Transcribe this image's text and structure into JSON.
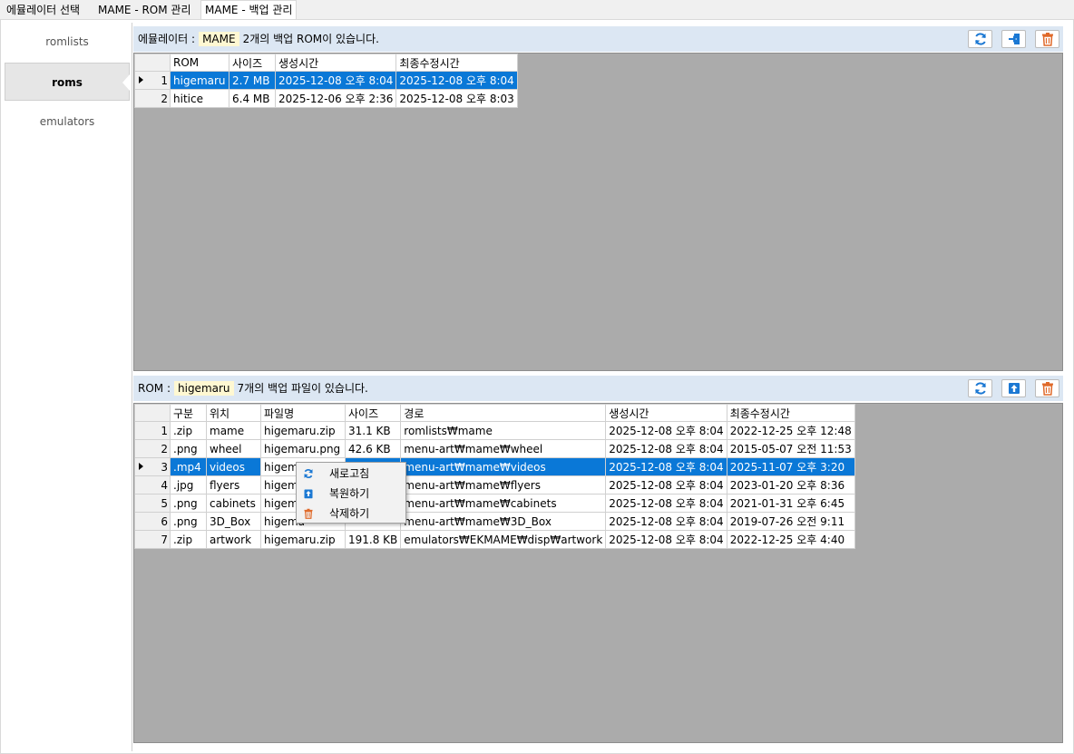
{
  "tabs": [
    {
      "label": "에뮬레이터 선택"
    },
    {
      "label": "MAME - ROM 관리"
    },
    {
      "label": "MAME - 백업 관리"
    }
  ],
  "nav": {
    "items": [
      {
        "label": "romlists"
      },
      {
        "label": "roms"
      },
      {
        "label": "emulators"
      }
    ]
  },
  "top_panel": {
    "label_prefix": "에뮬레이터 :",
    "emulator": "MAME",
    "message": "2개의 백업 ROM이 있습니다.",
    "columns": [
      "ROM",
      "사이즈",
      "생성시간",
      "최종수정시간"
    ],
    "rows": [
      {
        "num": "1",
        "rom": "higemaru",
        "size": "2.7 MB",
        "created": "2025-12-08 오후 8:04",
        "modified": "2025-12-08 오후 8:04"
      },
      {
        "num": "2",
        "rom": "hitice",
        "size": "6.4 MB",
        "created": "2025-12-06 오후 2:36",
        "modified": "2025-12-08 오후 8:03"
      }
    ]
  },
  "bottom_panel": {
    "label_prefix": "ROM :",
    "rom": "higemaru",
    "message": "7개의 백업 파일이 있습니다.",
    "columns": [
      "구분",
      "위치",
      "파일명",
      "사이즈",
      "경로",
      "생성시간",
      "최종수정시간"
    ],
    "rows": [
      {
        "num": "1",
        "type": ".zip",
        "loc": "mame",
        "file": "higemaru.zip",
        "size": "31.1 KB",
        "path": "romlists₩mame",
        "created": "2025-12-08 오후 8:04",
        "modified": "2022-12-25 오후 12:48"
      },
      {
        "num": "2",
        "type": ".png",
        "loc": "wheel",
        "file": "higemaru.png",
        "size": "42.6 KB",
        "path": "menu-art₩mame₩wheel",
        "created": "2025-12-08 오후 8:04",
        "modified": "2015-05-07 오전 11:53"
      },
      {
        "num": "3",
        "type": ".mp4",
        "loc": "videos",
        "file": "higema",
        "size": "",
        "path": "menu-art₩mame₩videos",
        "created": "2025-12-08 오후 8:04",
        "modified": "2025-11-07 오후 3:20"
      },
      {
        "num": "4",
        "type": ".jpg",
        "loc": "flyers",
        "file": "higema",
        "size": "",
        "path": "menu-art₩mame₩flyers",
        "created": "2025-12-08 오후 8:04",
        "modified": "2023-01-20 오후 8:36"
      },
      {
        "num": "5",
        "type": ".png",
        "loc": "cabinets",
        "file": "higema",
        "size": "",
        "path": "menu-art₩mame₩cabinets",
        "created": "2025-12-08 오후 8:04",
        "modified": "2021-01-31 오후 6:45"
      },
      {
        "num": "6",
        "type": ".png",
        "loc": "3D_Box",
        "file": "higema",
        "size": "",
        "path": "menu-art₩mame₩3D_Box",
        "created": "2025-12-08 오후 8:04",
        "modified": "2019-07-26 오전 9:11"
      },
      {
        "num": "7",
        "type": ".zip",
        "loc": "artwork",
        "file": "higemaru.zip",
        "size": "191.8 KB",
        "path": "emulators₩EKMAME₩disp₩artwork",
        "created": "2025-12-08 오후 8:04",
        "modified": "2022-12-25 오후 4:40"
      }
    ]
  },
  "context_menu": {
    "items": [
      {
        "label": "새로고침",
        "icon": "refresh-icon"
      },
      {
        "label": "복원하기",
        "icon": "restore-icon"
      },
      {
        "label": "삭제하기",
        "icon": "trash-icon"
      }
    ]
  },
  "colors": {
    "selection": "#0a78d7",
    "header_band": "#dce7f3",
    "icon_blue": "#1b78d3",
    "icon_orange": "#e06a2a",
    "grid_background": "#ababab"
  }
}
